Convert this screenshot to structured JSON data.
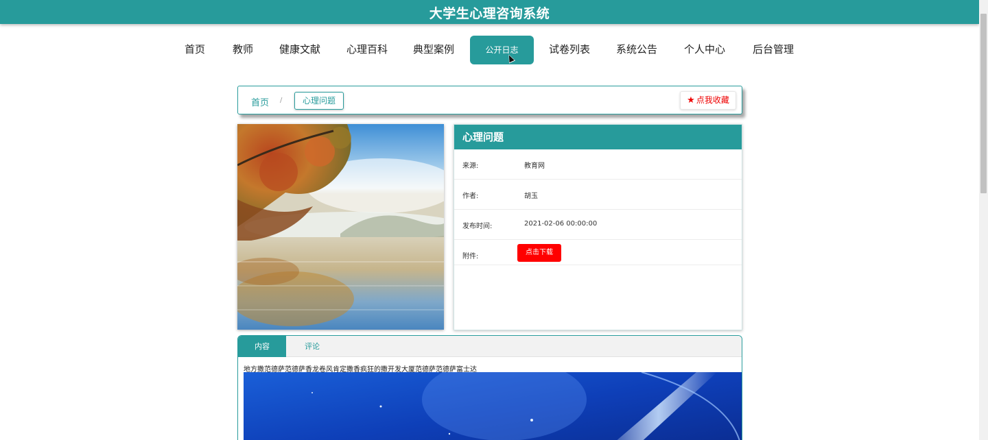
{
  "header": {
    "title": "大学生心理咨询系统"
  },
  "nav": {
    "items": [
      {
        "label": "首页"
      },
      {
        "label": "教师"
      },
      {
        "label": "健康文献"
      },
      {
        "label": "心理百科"
      },
      {
        "label": "典型案例"
      },
      {
        "label": "公开日志",
        "active": true
      },
      {
        "label": "试卷列表"
      },
      {
        "label": "系统公告"
      },
      {
        "label": "个人中心"
      },
      {
        "label": "后台管理"
      }
    ]
  },
  "breadcrumb": {
    "home": "首页",
    "separator": "/",
    "current": "心理问题"
  },
  "favorite": {
    "icon": "star-icon",
    "label": "点我收藏"
  },
  "detail": {
    "title": "心理问题",
    "source_label": "来源:",
    "source_value": "教育网",
    "author_label": "作者:",
    "author_value": "胡玉",
    "time_label": "发布时间:",
    "time_value": "2021-02-06 00:00:00",
    "attachment_label": "附件:",
    "download_label": "点击下载"
  },
  "tabs": [
    {
      "label": "内容",
      "active": true
    },
    {
      "label": "评论",
      "active": false
    }
  ],
  "content": {
    "text": "地方撒范德萨范德萨香龙卷风肯定撒香疯狂的撒开发大厦范德萨范德萨富士达"
  },
  "colors": {
    "accent": "#279b9b",
    "danger": "#ff0000",
    "favorite": "#e00000"
  }
}
